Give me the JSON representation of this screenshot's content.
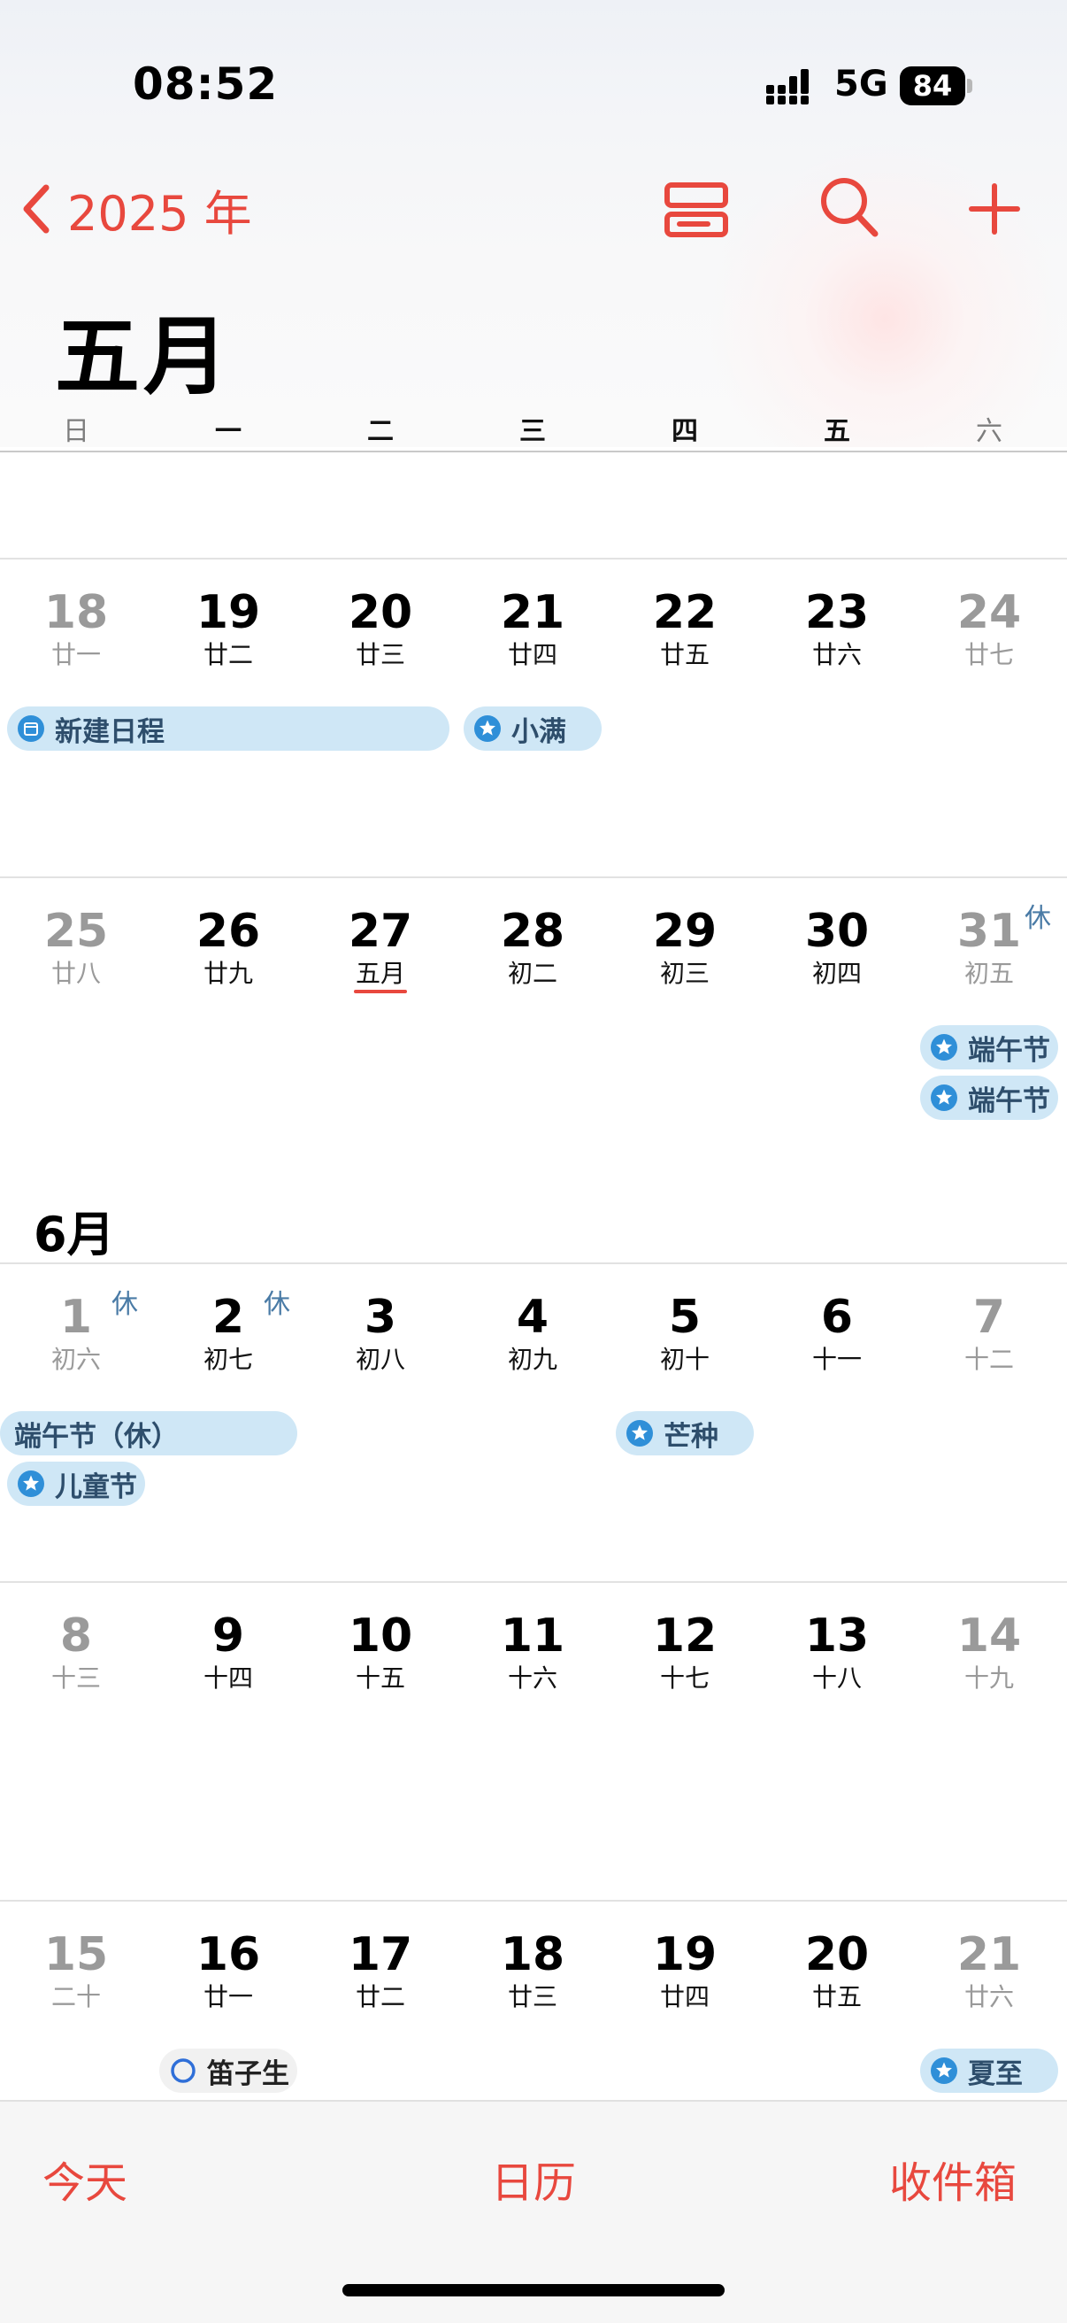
{
  "status": {
    "time": "08:52",
    "network": "5G",
    "battery": "84"
  },
  "nav": {
    "year_label": "2025 年",
    "month_title": "五月"
  },
  "weekdays": [
    "日",
    "一",
    "二",
    "三",
    "四",
    "五",
    "六"
  ],
  "weeks": [
    {
      "days": [
        {
          "num": "18",
          "lunar": "廿一"
        },
        {
          "num": "19",
          "lunar": "廿二"
        },
        {
          "num": "20",
          "lunar": "廿三"
        },
        {
          "num": "21",
          "lunar": "廿四"
        },
        {
          "num": "22",
          "lunar": "廿五"
        },
        {
          "num": "23",
          "lunar": "廿六"
        },
        {
          "num": "24",
          "lunar": "廿七"
        }
      ],
      "events": [
        {
          "label": "新建日程",
          "icon": "calendar",
          "start": 0,
          "span": 3,
          "row": 0
        },
        {
          "label": "小满",
          "icon": "star",
          "start": 3,
          "span": 1,
          "row": 0
        }
      ]
    },
    {
      "days": [
        {
          "num": "25",
          "lunar": "廿八"
        },
        {
          "num": "26",
          "lunar": "廿九"
        },
        {
          "num": "27",
          "lunar": "五月",
          "today": true
        },
        {
          "num": "28",
          "lunar": "初二"
        },
        {
          "num": "29",
          "lunar": "初三"
        },
        {
          "num": "30",
          "lunar": "初四"
        },
        {
          "num": "31",
          "lunar": "初五",
          "badge": "休"
        }
      ],
      "events": [
        {
          "label": "端午节",
          "icon": "star",
          "start": 6,
          "span": 1,
          "row": 0
        },
        {
          "label": "端午节",
          "icon": "star",
          "start": 6,
          "span": 1,
          "row": 1
        }
      ]
    },
    {
      "days": [
        {
          "num": "1",
          "lunar": "初六",
          "badge": "休"
        },
        {
          "num": "2",
          "lunar": "初七",
          "badge": "休"
        },
        {
          "num": "3",
          "lunar": "初八"
        },
        {
          "num": "4",
          "lunar": "初九"
        },
        {
          "num": "5",
          "lunar": "初十"
        },
        {
          "num": "6",
          "lunar": "十一"
        },
        {
          "num": "7",
          "lunar": "十二"
        }
      ],
      "events": [
        {
          "label": "端午节（休）",
          "icon": "none",
          "start": 0,
          "span": 2,
          "row": 0
        },
        {
          "label": "芒种",
          "icon": "star",
          "start": 4,
          "span": 1,
          "row": 0
        },
        {
          "label": "儿童节",
          "icon": "star",
          "start": 0,
          "span": 1,
          "row": 1
        }
      ]
    },
    {
      "days": [
        {
          "num": "8",
          "lunar": "十三"
        },
        {
          "num": "9",
          "lunar": "十四"
        },
        {
          "num": "10",
          "lunar": "十五"
        },
        {
          "num": "11",
          "lunar": "十六"
        },
        {
          "num": "12",
          "lunar": "十七"
        },
        {
          "num": "13",
          "lunar": "十八"
        },
        {
          "num": "14",
          "lunar": "十九"
        }
      ],
      "events": []
    },
    {
      "days": [
        {
          "num": "15",
          "lunar": "二十"
        },
        {
          "num": "16",
          "lunar": "廿一"
        },
        {
          "num": "17",
          "lunar": "廿二"
        },
        {
          "num": "18",
          "lunar": "廿三"
        },
        {
          "num": "19",
          "lunar": "廿四"
        },
        {
          "num": "20",
          "lunar": "廿五"
        },
        {
          "num": "21",
          "lunar": "廿六"
        }
      ],
      "events": [
        {
          "label": "笛子生",
          "icon": "circle",
          "start": 1,
          "span": 1,
          "row": 0
        },
        {
          "label": "夏至",
          "icon": "star",
          "start": 6,
          "span": 1,
          "row": 0
        }
      ]
    }
  ],
  "month_label_june": "6月",
  "tabs": {
    "today": "今天",
    "calendars": "日历",
    "inbox": "收件箱"
  },
  "colors": {
    "accent": "#e8483e",
    "event_bg": "#cfe7f6",
    "event_text": "#2e4e6c",
    "holiday_badge": "#4a7ba6"
  },
  "icons": {
    "back": "chevron-left-icon",
    "view": "list-view-icon",
    "search": "search-icon",
    "add": "plus-icon"
  }
}
